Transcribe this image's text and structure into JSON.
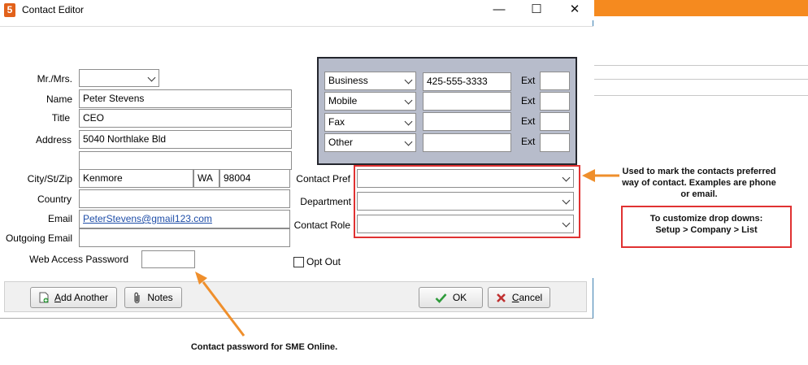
{
  "window": {
    "title": "Contact Editor",
    "app_icon": "5",
    "controls": {
      "minimize": "—",
      "maximize": "☐",
      "close": "✕"
    }
  },
  "form": {
    "salutation": {
      "label": "Mr./Mrs.",
      "value": ""
    },
    "name": {
      "label": "Name",
      "value": "Peter Stevens"
    },
    "title": {
      "label": "Title",
      "value": "CEO"
    },
    "address": {
      "label": "Address",
      "line1": "5040 Northlake Bld",
      "line2": ""
    },
    "city_st_zip": {
      "label": "City/St/Zip",
      "city": "Kenmore",
      "state": "WA",
      "zip": "98004"
    },
    "country": {
      "label": "Country",
      "value": ""
    },
    "email": {
      "label": "Email",
      "value": "PeterStevens@gmail123.com"
    },
    "outgoing_email": {
      "label": "Outgoing Email",
      "value": ""
    },
    "web_password": {
      "label": "Web Access Password",
      "value": ""
    }
  },
  "phones": {
    "ext_label": "Ext",
    "rows": [
      {
        "type": "Business",
        "number": "425-555-3333",
        "ext": ""
      },
      {
        "type": "Mobile",
        "number": "",
        "ext": ""
      },
      {
        "type": "Fax",
        "number": "",
        "ext": ""
      },
      {
        "type": "Other",
        "number": "",
        "ext": ""
      }
    ]
  },
  "prefs": {
    "contact_pref": {
      "label": "Contact Pref",
      "value": ""
    },
    "department": {
      "label": "Department",
      "value": ""
    },
    "contact_role": {
      "label": "Contact Role",
      "value": ""
    },
    "opt_out": {
      "label": "Opt Out",
      "checked": false
    }
  },
  "buttons": {
    "add_another": {
      "mnemonic": "A",
      "rest": "dd Another"
    },
    "notes": {
      "label": "Notes"
    },
    "ok": {
      "label": "OK"
    },
    "cancel": {
      "mnemonic": "C",
      "rest": "ancel"
    }
  },
  "annotations": {
    "contact_pref_note": "Used to mark the contacts preferred way of contact. Examples are phone or email.",
    "dropdown_note_line1": "To customize drop downs:",
    "dropdown_note_line2": "Setup > Company > List",
    "password_note": "Contact password for SME Online."
  },
  "colors": {
    "accent_orange": "#f58a1f",
    "annotation_red": "#e03232",
    "arrow_orange": "#ef8f2c",
    "phone_panel": "#b7bccb",
    "ok_check": "#2e9b3a",
    "cancel_x": "#c03030"
  }
}
